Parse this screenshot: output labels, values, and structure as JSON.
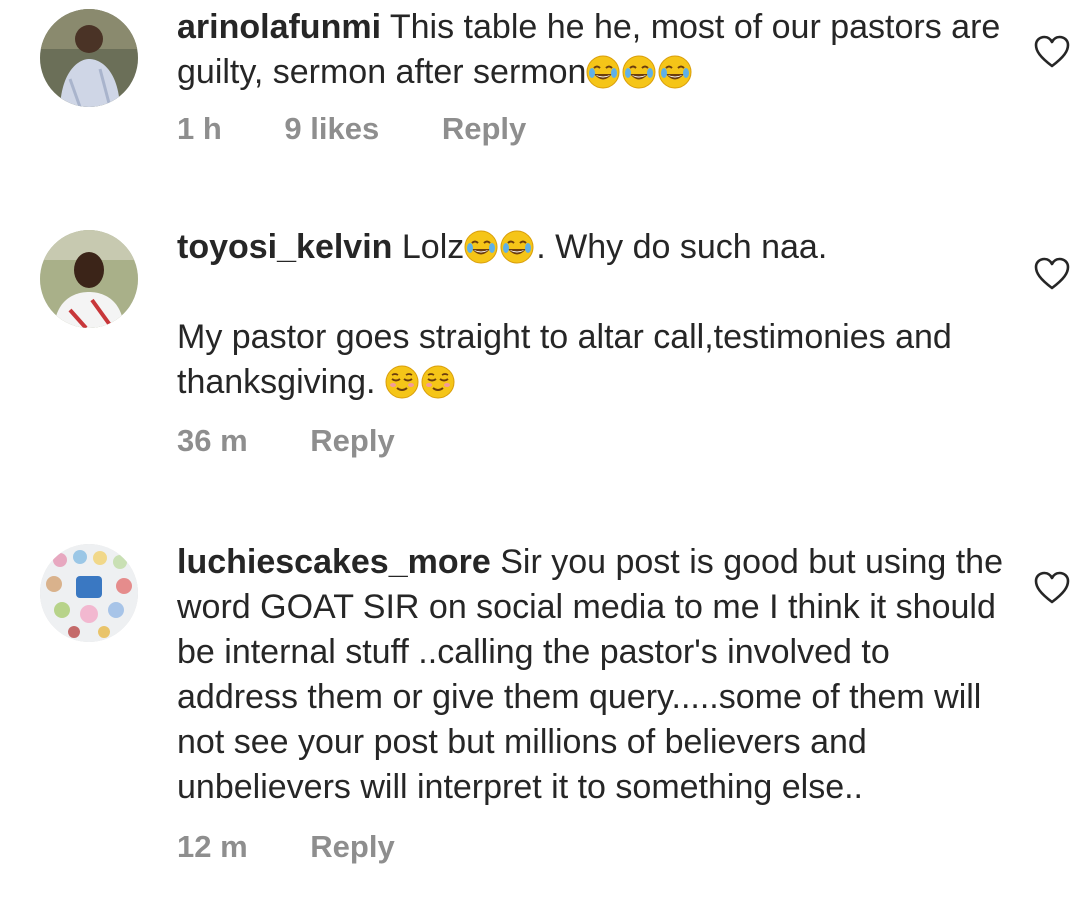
{
  "comments": [
    {
      "username": "arinolafunmi",
      "paragraphs": [
        "This table he he, most of our pastors are guilty, sermon after sermon"
      ],
      "emoji_after": [
        "laughing-tears",
        "laughing-tears",
        "laughing-tears"
      ],
      "time": "1 h",
      "likes": "9 likes",
      "reply": "Reply"
    },
    {
      "username": "toyosi_kelvin",
      "para1_before": "Lolz",
      "para1_emoji": [
        "laughing-tears",
        "laughing-tears"
      ],
      "para1_after": ". Why do such naa.",
      "para2": "My pastor goes straight to altar call,testimonies and thanksgiving. ",
      "para2_emoji": [
        "relieved-face",
        "relieved-face"
      ],
      "time": "36 m",
      "reply": "Reply"
    },
    {
      "username": "luchiescakes_more",
      "text": "Sir you post is good but using the word GOAT SIR on social media to me I think it should be internal stuff ..calling the pastor's involved to address them or give them query.....some of them will not see your post but millions of believers and unbelievers will interpret it to something else..",
      "time": "12 m",
      "reply": "Reply"
    }
  ],
  "colors": {
    "text": "#262626",
    "meta": "#8e8e8e",
    "emoji": "#f5c518"
  },
  "icons": {
    "like": "heart-outline-icon",
    "avatar": "profile-photo"
  }
}
